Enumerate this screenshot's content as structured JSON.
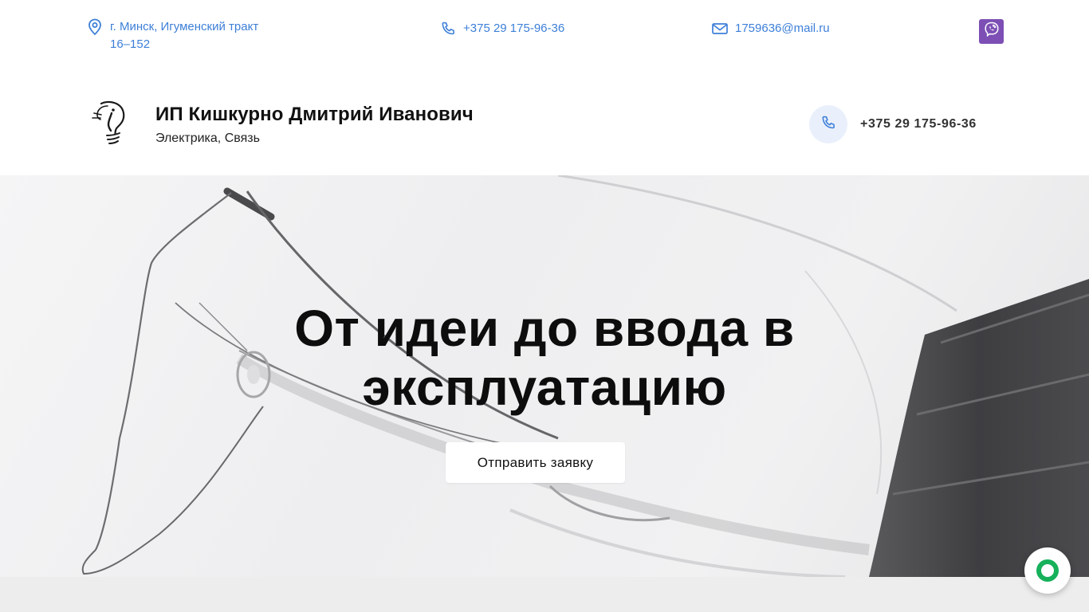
{
  "topbar": {
    "address": "г. Минск, Игуменский тракт 16–152",
    "phone": "+375 29 175-96-36",
    "email": "1759636@mail.ru",
    "viber_icon": "viber-icon",
    "accent_color": "#3d7fd8",
    "viber_color": "#7d4fb5"
  },
  "header": {
    "title": "ИП Кишкурно Дмитрий Иванович",
    "subtitle": "Электрика, Связь",
    "phone": "+375 29 175-96-36",
    "logo_icon": "lightbulb-logo-icon"
  },
  "hero": {
    "title": "От идеи до ввода в эксплуатацию",
    "cta_label": "Отправить заявку"
  },
  "widget": {
    "icon": "chat-ring-icon",
    "color": "#16b15a"
  }
}
